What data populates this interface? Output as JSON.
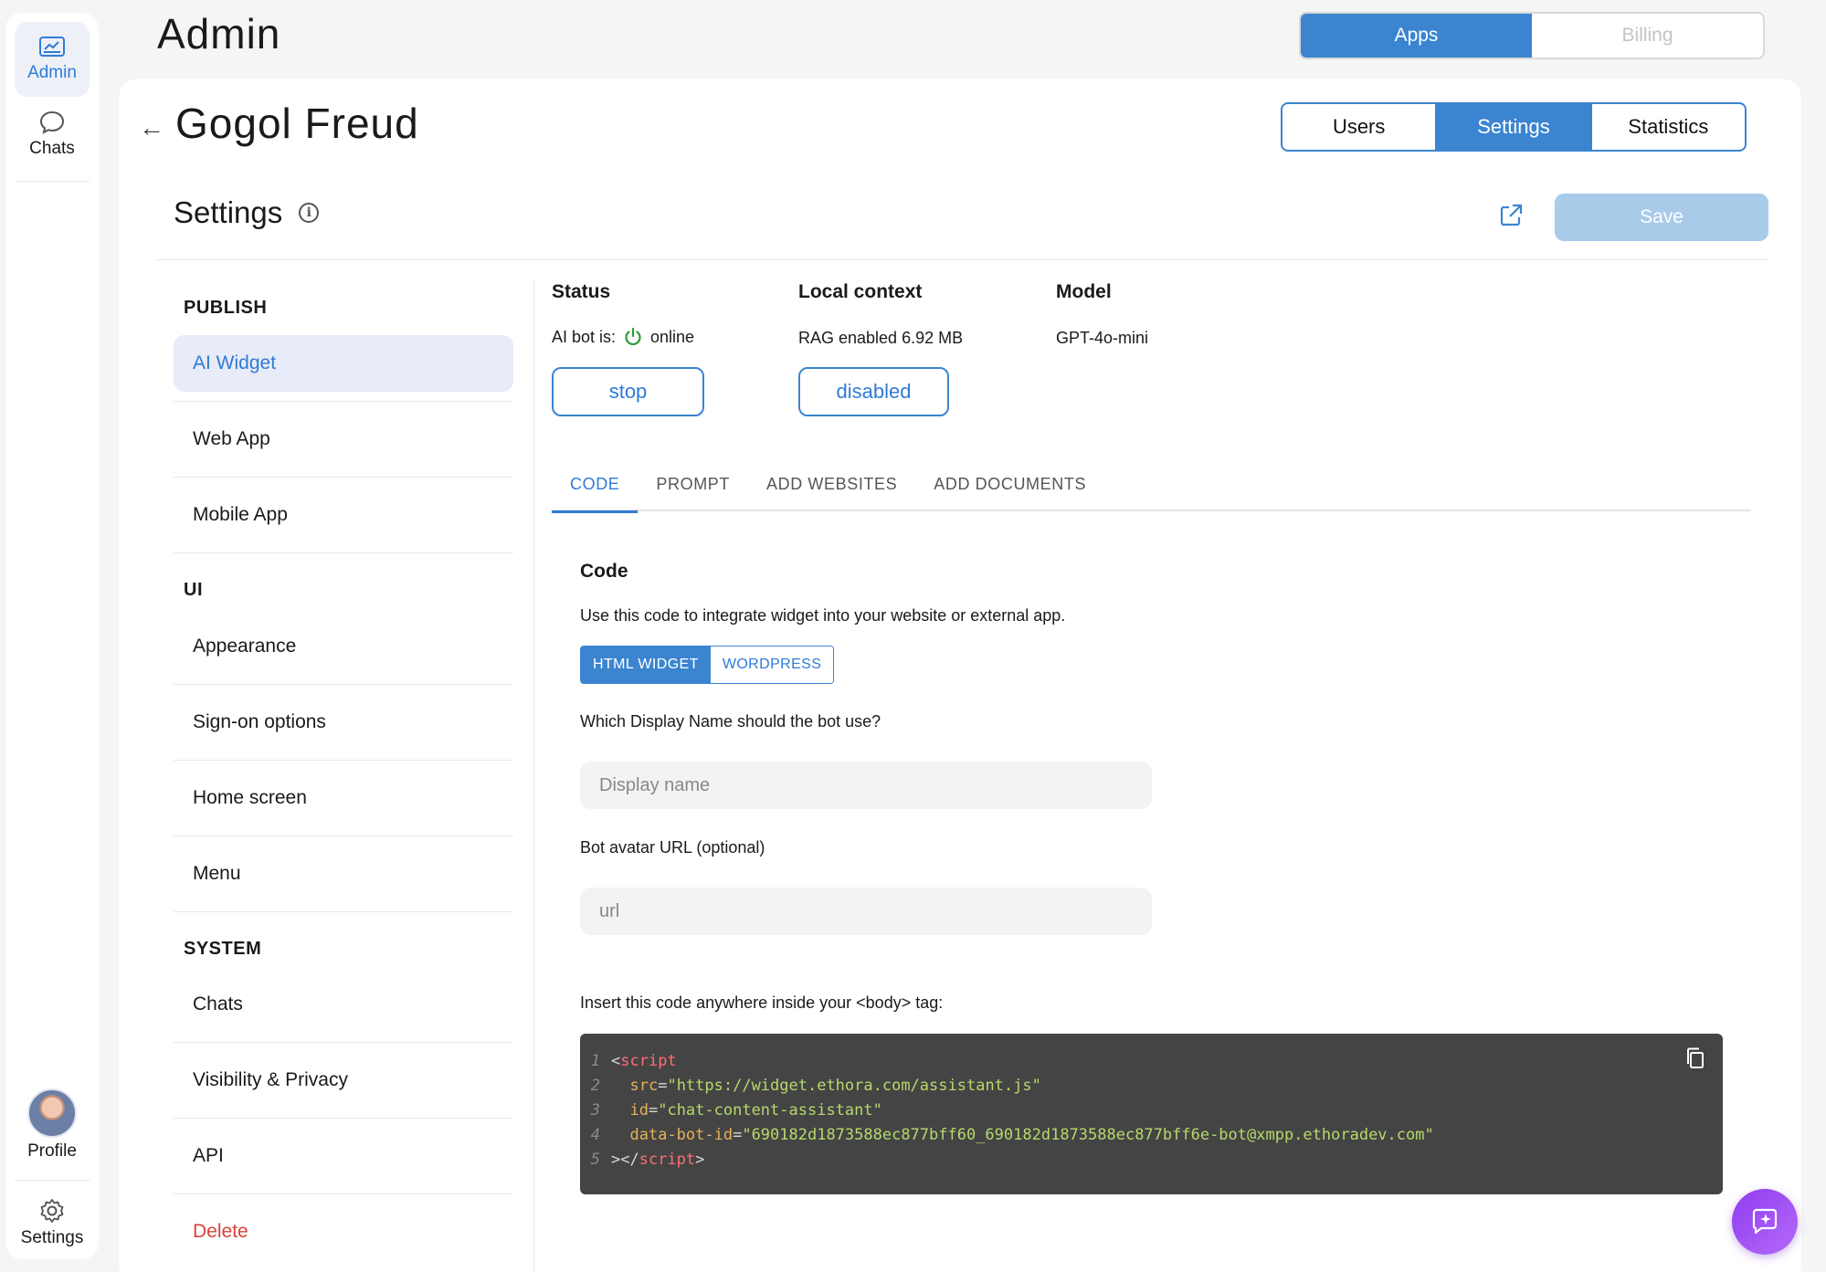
{
  "rail": {
    "admin_label": "Admin",
    "chats_label": "Chats",
    "profile_label": "Profile",
    "settings_label": "Settings"
  },
  "header": {
    "title": "Admin",
    "toggle": [
      "Apps",
      "Billing"
    ]
  },
  "app": {
    "name": "Gogol Freud",
    "tabs": [
      "Users",
      "Settings",
      "Statistics"
    ]
  },
  "settings": {
    "title": "Settings",
    "save_label": "Save"
  },
  "menu": {
    "publish_head": "PUBLISH",
    "ai_widget": "AI Widget",
    "web_app": "Web App",
    "mobile_app": "Mobile App",
    "ui_head": "UI",
    "appearance": "Appearance",
    "sign_on": "Sign-on options",
    "home_screen": "Home screen",
    "menu": "Menu",
    "system_head": "SYSTEM",
    "chats": "Chats",
    "visibility": "Visibility & Privacy",
    "api": "API",
    "delete": "Delete"
  },
  "status": {
    "status_head": "Status",
    "bot_label": "AI bot is:",
    "bot_state": "online",
    "stop_label": "stop",
    "context_head": "Local context",
    "context_value": "RAG enabled 6.92 MB",
    "disabled_label": "disabled",
    "model_head": "Model",
    "model_value": "GPT-4o-mini"
  },
  "tabs": [
    "CODE",
    "PROMPT",
    "ADD WEBSITES",
    "ADD DOCUMENTS"
  ],
  "code_section": {
    "title": "Code",
    "description": "Use this code to integrate widget into your website or external app.",
    "toggle": [
      "HTML WIDGET",
      "WORDPRESS"
    ],
    "display_name_label": "Which Display Name should the bot use?",
    "display_name_placeholder": "Display name",
    "avatar_label": "Bot avatar URL (optional)",
    "avatar_placeholder": "url",
    "insert_label": "Insert this code anywhere inside your <body> tag:",
    "lines": [
      {
        "n": "1",
        "open": "<",
        "tag": "script"
      },
      {
        "n": "2",
        "attr": "src",
        "val": "\"https://widget.ethora.com/assistant.js\""
      },
      {
        "n": "3",
        "attr": "id",
        "val": "\"chat-content-assistant\""
      },
      {
        "n": "4",
        "attr": "data-bot-id",
        "val": "\"690182d1873588ec877bff60_690182d1873588ec877bff6e-bot@xmpp.ethoradev.com\""
      },
      {
        "n": "5",
        "close": "></",
        "tag": "script",
        "end": ">"
      }
    ]
  },
  "colors": {
    "accent": "#3b84d0",
    "save_disabled": "#a9cbea",
    "danger": "#d9423a",
    "online": "#2e9b3f",
    "fab": "#9b4cf4"
  }
}
